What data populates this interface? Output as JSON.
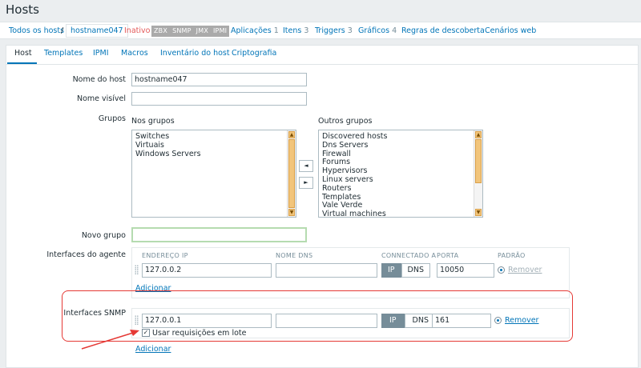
{
  "page": {
    "title": "Hosts"
  },
  "breadcrumbs": {
    "all_hosts": "Todos os hosts",
    "separator": "/",
    "current_host": "hostname047",
    "status": "Inativo",
    "availability": [
      "ZBX",
      "SNMP",
      "JMX",
      "IPMI"
    ],
    "links": [
      {
        "label": "Aplicações",
        "count": "1"
      },
      {
        "label": "Itens",
        "count": "3"
      },
      {
        "label": "Triggers",
        "count": "3"
      },
      {
        "label": "Gráficos",
        "count": "4"
      },
      {
        "label": "Regras de descoberta",
        "count": ""
      },
      {
        "label": "Cenários web",
        "count": ""
      }
    ]
  },
  "tabs": [
    "Host",
    "Templates",
    "IPMI",
    "Macros",
    "Inventário do host",
    "Criptografia"
  ],
  "form": {
    "host_name": {
      "label": "Nome do host",
      "value": "hostname047"
    },
    "visible_name": {
      "label": "Nome visível",
      "value": ""
    },
    "groups": {
      "label": "Grupos",
      "in_groups_title": "Nos grupos",
      "other_groups_title": "Outros grupos",
      "in_groups": [
        "Switches",
        "Virtuais",
        "Windows Servers"
      ],
      "other_groups": [
        "Discovered hosts",
        "Dns Servers",
        "Firewall",
        "Forums",
        "Hypervisors",
        "Linux servers",
        "Routers",
        "Templates",
        "Vale Verde",
        "Virtual machines"
      ],
      "move_left": "◄",
      "move_right": "►"
    },
    "new_group": {
      "label": "Novo grupo",
      "value": ""
    },
    "agent_interfaces": {
      "label": "Interfaces do agente",
      "columns": [
        "ENDEREÇO IP",
        "NOME DNS",
        "CONNECTADO A",
        "PORTA",
        "PADRÃO"
      ],
      "ip": "127.0.0.2",
      "dns": "",
      "connect_ip": "IP",
      "connect_dns": "DNS",
      "port": "10050",
      "remove": "Remover",
      "add": "Adicionar"
    },
    "snmp_interfaces": {
      "label": "Interfaces SNMP",
      "ip": "127.0.0.1",
      "dns": "",
      "connect_ip": "IP",
      "connect_dns": "DNS",
      "port": "161",
      "remove": "Remover",
      "bulk_label": "Usar requisições em lote",
      "bulk_checked": true,
      "add": "Adicionar"
    }
  },
  "colors": {
    "link": "#0275b8",
    "inactive": "#e45959",
    "highlight": "#e53935",
    "active_segment": "#768d99"
  }
}
